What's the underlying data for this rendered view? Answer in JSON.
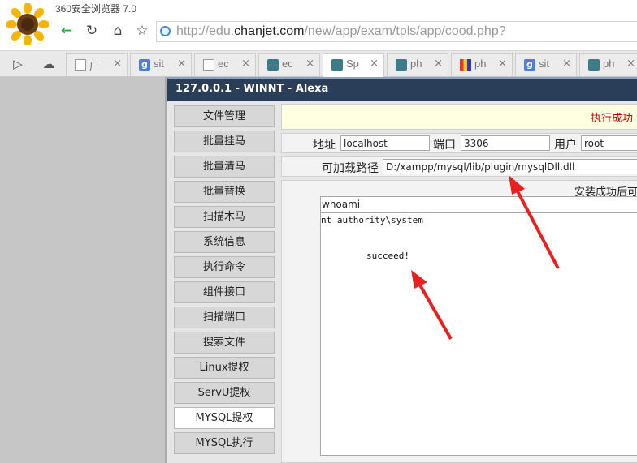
{
  "browser": {
    "title": "360安全浏览器 7.0",
    "url_prefix": "http://edu.",
    "url_domain": "chanjet.com",
    "url_path": "/new/app/exam/tpls/app/cood.php?"
  },
  "tabs": [
    {
      "label": "厂",
      "icon": "document-icon"
    },
    {
      "label": "sit",
      "icon": "google-icon"
    },
    {
      "label": "ec",
      "icon": "document-icon"
    },
    {
      "label": "ec",
      "icon": "gear-icon"
    },
    {
      "label": "Sp",
      "icon": "gear-icon",
      "active": true
    },
    {
      "label": "ph",
      "icon": "gear-icon"
    },
    {
      "label": "ph",
      "icon": "colorful-icon"
    },
    {
      "label": "sit",
      "icon": "google-icon"
    },
    {
      "label": "ph",
      "icon": "gear-icon"
    }
  ],
  "app": {
    "header": "127.0.0.1 - WINNT - Alexa",
    "menu": [
      "文件管理",
      "批量挂马",
      "批量清马",
      "批量替换",
      "扫描木马",
      "系统信息",
      "执行命令",
      "组件接口",
      "扫描端口",
      "搜索文件",
      "Linux提权",
      "ServU提权",
      "MYSQL提权",
      "MYSQL执行"
    ],
    "active_menu": "MYSQL提权",
    "notice": "执行成功",
    "conn": {
      "addr_label": "地址",
      "addr_value": "localhost",
      "port_label": "端口",
      "port_value": "3306",
      "user_label": "用户",
      "user_value": "root"
    },
    "dll": {
      "label": "可加载路径",
      "value": "D:/xampp/mysql/lib/plugin/mysqlDll.dll"
    },
    "hint": "安装成功后可",
    "command_value": "whoami",
    "output_line1": "nt authority\\system",
    "output_line2": "succeed!"
  },
  "colors": {
    "header_bg": "#2a3e57",
    "notice_bg": "#ffffe1",
    "notice_text": "#c00000",
    "arrow": "#e82020"
  }
}
